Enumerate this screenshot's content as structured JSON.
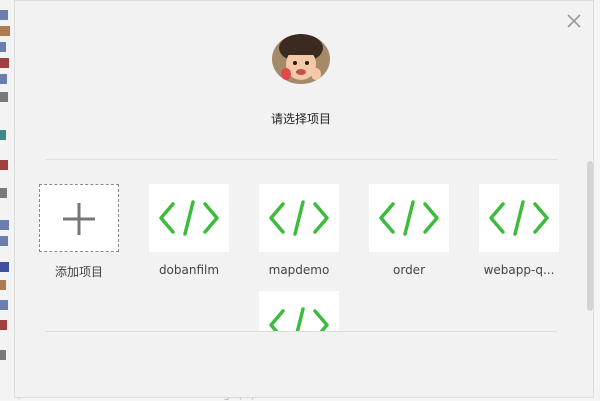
{
  "dialog": {
    "title": "请选择项目",
    "close_icon": "close-icon",
    "add_project": {
      "label": "添加项目",
      "icon": "plus-icon"
    },
    "projects": [
      {
        "label": "dobanfilm",
        "icon": "code-icon"
      },
      {
        "label": "mapdemo",
        "icon": "code-icon"
      },
      {
        "label": "order",
        "icon": "code-icon"
      },
      {
        "label": "webapp-q...",
        "icon": "code-icon"
      },
      {
        "label": "",
        "icon": "code-icon"
      }
    ]
  },
  "background": {
    "bottom_code": "/ftall.effectLeft: all.effectHigh(3)"
  },
  "colors": {
    "accent": "#3dbb3d",
    "dialog_bg": "#f2f2f2",
    "tile_bg": "#ffffff"
  }
}
